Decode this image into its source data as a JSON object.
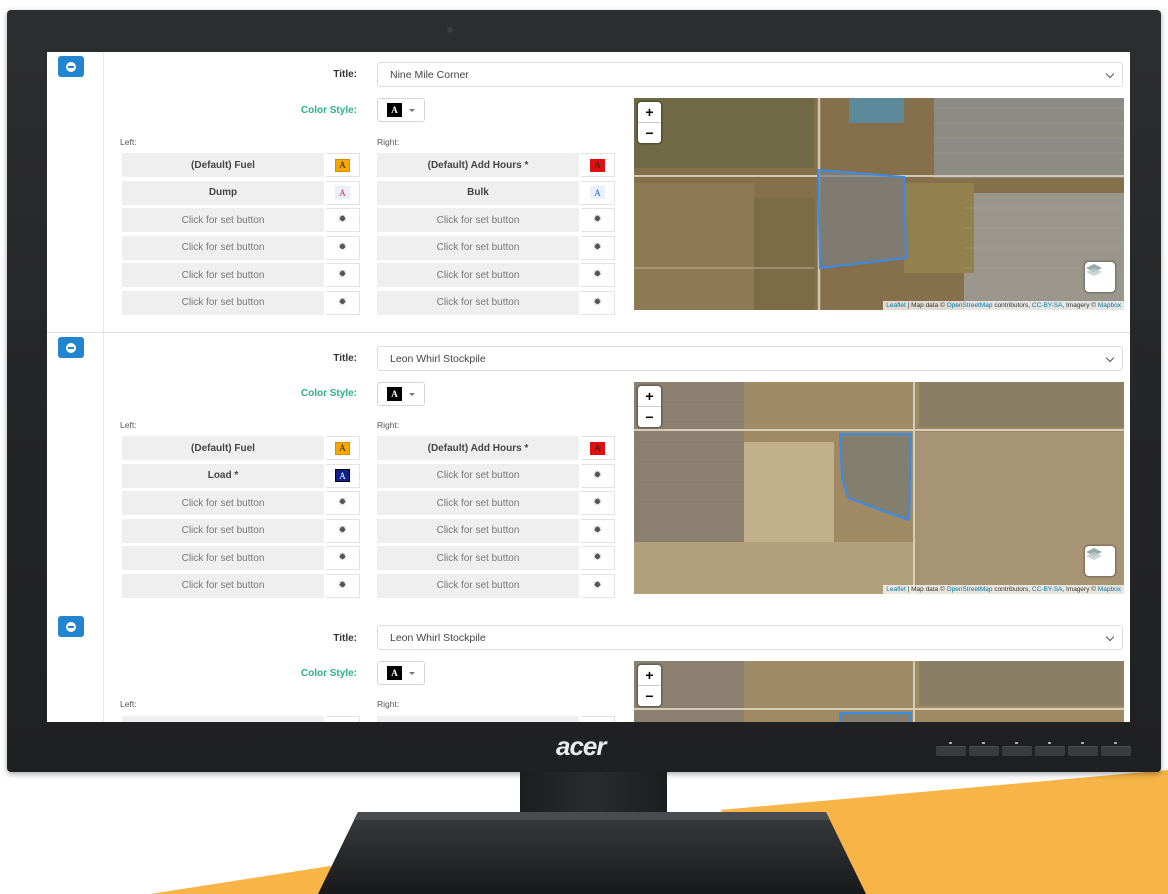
{
  "colors": {
    "accent": "#2185d0",
    "color_style_label": "#2cb08e",
    "backdrop_orange": "#f8b446"
  },
  "monitor": {
    "brand": "acer"
  },
  "map_attribution": {
    "leaflet": "Leaflet",
    "sep1": " | Map data © ",
    "osm": "OpenStreetMap",
    "sep2": " contributors, ",
    "license": "CC-BY-SA",
    "sep3": ", Imagery © ",
    "mapbox": "Mapbox"
  },
  "labels": {
    "title": "Title:",
    "color_style": "Color Style:",
    "left": "Left:",
    "right": "Right:",
    "style_glyph": "A",
    "zoom_in": "+",
    "zoom_out": "−"
  },
  "panels": [
    {
      "title_value": "Nine Mile Corner",
      "left": [
        {
          "label": "(Default) Fuel",
          "chip": {
            "bg": "#f6a800",
            "fg": "#222",
            "text": "A"
          }
        },
        {
          "label": "Dump",
          "chip": {
            "bg": "#e9f0fb",
            "fg": "#d33",
            "text": "A"
          }
        },
        {
          "label": "Click for set button",
          "icon": "gear-icon"
        },
        {
          "label": "Click for set button",
          "icon": "gear-icon"
        },
        {
          "label": "Click for set button",
          "icon": "gear-icon"
        },
        {
          "label": "Click for set button",
          "icon": "gear-icon"
        }
      ],
      "right": [
        {
          "label": "(Default) Add Hours *",
          "chip": {
            "bg": "#e01010",
            "fg": "#222",
            "text": "A"
          }
        },
        {
          "label": "Bulk",
          "chip": {
            "bg": "#e9f0fb",
            "fg": "#2266cc",
            "text": "A"
          }
        },
        {
          "label": "Click for set button",
          "icon": "gear-icon"
        },
        {
          "label": "Click for set button",
          "icon": "gear-icon"
        },
        {
          "label": "Click for set button",
          "icon": "gear-icon"
        },
        {
          "label": "Click for set button",
          "icon": "gear-icon"
        }
      ]
    },
    {
      "title_value": "Leon Whirl Stockpile",
      "left": [
        {
          "label": "(Default) Fuel",
          "chip": {
            "bg": "#f6a800",
            "fg": "#222",
            "text": "A"
          }
        },
        {
          "label": "Load *",
          "chip": {
            "bg": "#10208a",
            "fg": "#fff",
            "text": "A"
          }
        },
        {
          "label": "Click for set button",
          "icon": "gear-icon"
        },
        {
          "label": "Click for set button",
          "icon": "gear-icon"
        },
        {
          "label": "Click for set button",
          "icon": "gear-icon"
        },
        {
          "label": "Click for set button",
          "icon": "gear-icon"
        }
      ],
      "right": [
        {
          "label": "(Default) Add Hours *",
          "chip": {
            "bg": "#e01010",
            "fg": "#222",
            "text": "A"
          }
        },
        {
          "label": "Click for set button",
          "icon": "gear-icon"
        },
        {
          "label": "Click for set button",
          "icon": "gear-icon"
        },
        {
          "label": "Click for set button",
          "icon": "gear-icon"
        },
        {
          "label": "Click for set button",
          "icon": "gear-icon"
        },
        {
          "label": "Click for set button",
          "icon": "gear-icon"
        }
      ]
    },
    {
      "title_value": "Leon Whirl Stockpile",
      "left": [
        {
          "label": "",
          "chip": {
            "bg": "#f6a800",
            "fg": "#222",
            "text": ""
          }
        }
      ],
      "right": [
        {
          "label": "",
          "chip": {
            "bg": "#e01010",
            "fg": "#222",
            "text": ""
          }
        }
      ]
    }
  ]
}
